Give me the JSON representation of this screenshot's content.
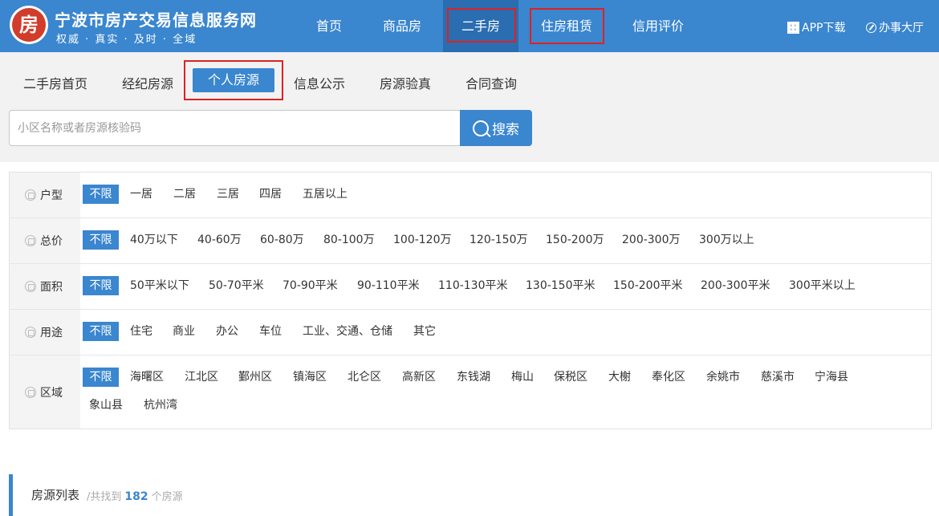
{
  "header": {
    "logo_char": "房",
    "site_title": "宁波市房产交易信息服务网",
    "slogan": "权威 · 真实 · 及时 · 全域",
    "nav": [
      "首页",
      "商品房",
      "二手房",
      "住房租赁",
      "信用评价"
    ],
    "app_download": "APP下载",
    "service_hall": "办事大厅"
  },
  "subnav": {
    "items": [
      "二手房首页",
      "经纪房源",
      "个人房源",
      "信息公示",
      "房源验真",
      "合同查询"
    ],
    "active": "个人房源"
  },
  "search": {
    "placeholder": "小区名称或者房源核验码",
    "button": "搜索"
  },
  "filters": {
    "all_label": "不限",
    "layout": {
      "label": "户型",
      "options": [
        "一居",
        "二居",
        "三居",
        "四居",
        "五居以上"
      ]
    },
    "price": {
      "label": "总价",
      "options": [
        "40万以下",
        "40-60万",
        "60-80万",
        "80-100万",
        "100-120万",
        "120-150万",
        "150-200万",
        "200-300万",
        "300万以上"
      ]
    },
    "area": {
      "label": "面积",
      "options": [
        "50平米以下",
        "50-70平米",
        "70-90平米",
        "90-110平米",
        "110-130平米",
        "130-150平米",
        "150-200平米",
        "200-300平米",
        "300平米以上"
      ]
    },
    "usage": {
      "label": "用途",
      "options": [
        "住宅",
        "商业",
        "办公",
        "车位",
        "工业、交通、仓储",
        "其它"
      ]
    },
    "district": {
      "label": "区域",
      "options": [
        "海曙区",
        "江北区",
        "鄞州区",
        "镇海区",
        "北仑区",
        "高新区",
        "东钱湖",
        "梅山",
        "保税区",
        "大榭",
        "奉化区",
        "余姚市",
        "慈溪市",
        "宁海县",
        "象山县",
        "杭州湾"
      ]
    }
  },
  "results": {
    "title": "房源列表",
    "prefix": "/共找到",
    "count": "182",
    "suffix": "个房源"
  }
}
